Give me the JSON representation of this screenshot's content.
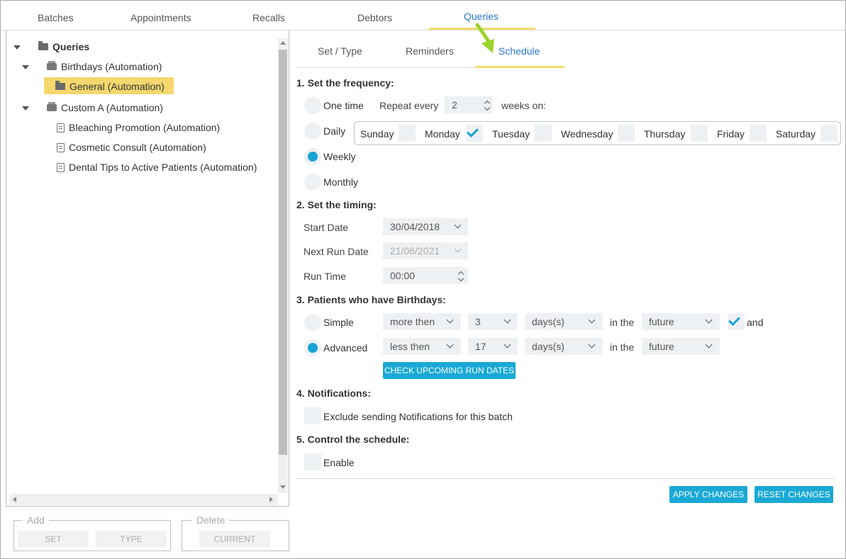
{
  "top_tabs": {
    "batches": "Batches",
    "appointments": "Appointments",
    "recalls": "Recalls",
    "debtors": "Debtors",
    "queries": "Queries"
  },
  "tree": {
    "root": "Queries",
    "birthdays": "Birthdays (Automation)",
    "general": "General (Automation)",
    "custom_a": "Custom A (Automation)",
    "bleaching": "Bleaching Promotion (Automation)",
    "cosmetic": "Cosmetic Consult (Automation)",
    "dental_tips": "Dental Tips to Active Patients (Automation)"
  },
  "left_actions": {
    "add_legend": "Add",
    "set": "SET",
    "type": "TYPE",
    "delete_legend": "Delete",
    "current": "CURRENT"
  },
  "sub_tabs": {
    "set_type": "Set / Type",
    "reminders": "Reminders",
    "schedule": "Schedule"
  },
  "frequency": {
    "heading": "1. Set the frequency:",
    "one_time": "One time",
    "daily": "Daily",
    "weekly": "Weekly",
    "monthly": "Monthly",
    "selected": "Weekly",
    "repeat_every_label": "Repeat every",
    "repeat_every_value": "2",
    "weeks_on": "weeks on:",
    "days": {
      "sunday": "Sunday",
      "monday": "Monday",
      "tuesday": "Tuesday",
      "wednesday": "Wednesday",
      "thursday": "Thursday",
      "friday": "Friday",
      "saturday": "Saturday"
    },
    "checked_days": [
      "Monday"
    ]
  },
  "timing": {
    "heading": "2. Set the timing:",
    "start_date_label": "Start Date",
    "start_date_value": "30/04/2018",
    "next_run_label": "Next Run Date",
    "next_run_value": "21/06/2021",
    "run_time_label": "Run Time",
    "run_time_value": "00:00"
  },
  "birthdays": {
    "heading": "3. Patients who have Birthdays:",
    "simple_label": "Simple",
    "advanced_label": "Advanced",
    "selected": "Advanced",
    "simple": {
      "comparator": "more then",
      "amount": "3",
      "unit": "days(s)",
      "in_the": "in the",
      "direction": "future"
    },
    "and_label": "and",
    "and_checked": true,
    "advanced": {
      "comparator": "less then",
      "amount": "17",
      "unit": "days(s)",
      "in_the": "in the",
      "direction": "future"
    },
    "check_button": "CHECK UPCOMING RUN DATES"
  },
  "notifications": {
    "heading": "4. Notifications:",
    "exclude_label": "Exclude sending Notifications for this batch",
    "exclude_checked": false
  },
  "control": {
    "heading": "5. Control the schedule:",
    "enable_label": "Enable",
    "enable_checked": false
  },
  "footer": {
    "apply": "APPLY CHANGES",
    "reset": "RESET CHANGES"
  },
  "colors": {
    "accent_blue": "#19a9d4",
    "tab_active": "#2a78c9",
    "selection_yellow": "#f5d76e",
    "arrow_green": "#9bd42a"
  }
}
